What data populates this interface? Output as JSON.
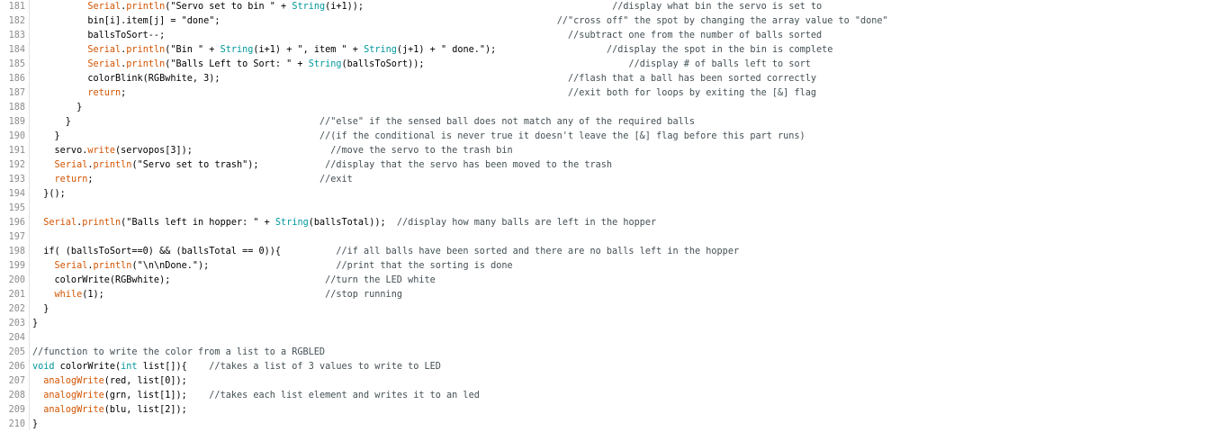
{
  "editor": {
    "lines": [
      {
        "n": "181",
        "segs": [
          [
            "p",
            "          "
          ],
          [
            "f",
            "Serial"
          ],
          [
            "p",
            "."
          ],
          [
            "f",
            "println"
          ],
          [
            "p",
            "(\"Servo set to bin \" + "
          ],
          [
            "t",
            "String"
          ],
          [
            "p",
            "(i+1));                                             "
          ],
          [
            "c",
            "//display what bin the servo is set to"
          ]
        ]
      },
      {
        "n": "182",
        "segs": [
          [
            "p",
            "          bin[i].item[j] = \"done\";                                                             "
          ],
          [
            "c",
            "//\"cross off\" the spot by changing the array value to \"done\""
          ]
        ]
      },
      {
        "n": "183",
        "segs": [
          [
            "p",
            "          ballsToSort--;                                                                         "
          ],
          [
            "c",
            "//subtract one from the number of balls sorted"
          ]
        ]
      },
      {
        "n": "184",
        "segs": [
          [
            "p",
            "          "
          ],
          [
            "f",
            "Serial"
          ],
          [
            "p",
            "."
          ],
          [
            "f",
            "println"
          ],
          [
            "p",
            "(\"Bin \" + "
          ],
          [
            "t",
            "String"
          ],
          [
            "p",
            "(i+1) + \", item \" + "
          ],
          [
            "t",
            "String"
          ],
          [
            "p",
            "(j+1) + \" done.\");                    "
          ],
          [
            "c",
            "//display the spot in the bin is complete"
          ]
        ]
      },
      {
        "n": "185",
        "segs": [
          [
            "p",
            "          "
          ],
          [
            "f",
            "Serial"
          ],
          [
            "p",
            "."
          ],
          [
            "f",
            "println"
          ],
          [
            "p",
            "(\"Balls Left to Sort: \" + "
          ],
          [
            "t",
            "String"
          ],
          [
            "p",
            "(ballsToSort));                                     "
          ],
          [
            "c",
            "//display # of balls left to sort"
          ]
        ]
      },
      {
        "n": "186",
        "segs": [
          [
            "p",
            "          colorBlink(RGBwhite, 3);                                                               "
          ],
          [
            "c",
            "//flash that a ball has been sorted correctly"
          ]
        ]
      },
      {
        "n": "187",
        "segs": [
          [
            "p",
            "          "
          ],
          [
            "f",
            "return"
          ],
          [
            "p",
            ";                                                                                "
          ],
          [
            "c",
            "//exit both for loops by exiting the [&] flag"
          ]
        ]
      },
      {
        "n": "188",
        "segs": [
          [
            "p",
            "        }"
          ]
        ]
      },
      {
        "n": "189",
        "segs": [
          [
            "p",
            "      }                                             "
          ],
          [
            "c",
            "//\"else\" if the sensed ball does not match any of the required balls"
          ]
        ]
      },
      {
        "n": "190",
        "segs": [
          [
            "p",
            "    }                                               "
          ],
          [
            "c",
            "//(if the conditional is never true it doesn't leave the [&] flag before this part runs)"
          ]
        ]
      },
      {
        "n": "191",
        "segs": [
          [
            "p",
            "    servo."
          ],
          [
            "f",
            "write"
          ],
          [
            "p",
            "(servopos[3]);                         "
          ],
          [
            "c",
            "//move the servo to the trash bin"
          ]
        ]
      },
      {
        "n": "192",
        "segs": [
          [
            "p",
            "    "
          ],
          [
            "f",
            "Serial"
          ],
          [
            "p",
            "."
          ],
          [
            "f",
            "println"
          ],
          [
            "p",
            "(\"Servo set to trash\");            "
          ],
          [
            "c",
            "//display that the servo has been moved to the trash"
          ]
        ]
      },
      {
        "n": "193",
        "segs": [
          [
            "p",
            "    "
          ],
          [
            "f",
            "return"
          ],
          [
            "p",
            ";                                         "
          ],
          [
            "c",
            "//exit"
          ]
        ]
      },
      {
        "n": "194",
        "segs": [
          [
            "p",
            "  }();"
          ]
        ]
      },
      {
        "n": "195",
        "segs": [
          [
            "p",
            ""
          ]
        ]
      },
      {
        "n": "196",
        "segs": [
          [
            "p",
            "  "
          ],
          [
            "f",
            "Serial"
          ],
          [
            "p",
            "."
          ],
          [
            "f",
            "println"
          ],
          [
            "p",
            "(\"Balls left in hopper: \" + "
          ],
          [
            "t",
            "String"
          ],
          [
            "p",
            "(ballsTotal));  "
          ],
          [
            "c",
            "//display how many balls are left in the hopper"
          ]
        ]
      },
      {
        "n": "197",
        "segs": [
          [
            "p",
            ""
          ]
        ]
      },
      {
        "n": "198",
        "segs": [
          [
            "p",
            "  if( (ballsToSort==0) && (ballsTotal == 0)){          "
          ],
          [
            "c",
            "//if all balls have been sorted and there are no balls left in the hopper"
          ]
        ]
      },
      {
        "n": "199",
        "segs": [
          [
            "p",
            "    "
          ],
          [
            "f",
            "Serial"
          ],
          [
            "p",
            "."
          ],
          [
            "f",
            "println"
          ],
          [
            "p",
            "(\"\\n\\nDone.\");                       "
          ],
          [
            "c",
            "//print that the sorting is done"
          ]
        ]
      },
      {
        "n": "200",
        "segs": [
          [
            "p",
            "    colorWrite(RGBwhite);                            "
          ],
          [
            "c",
            "//turn the LED white"
          ]
        ]
      },
      {
        "n": "201",
        "segs": [
          [
            "p",
            "    "
          ],
          [
            "f",
            "while"
          ],
          [
            "p",
            "(1);                                        "
          ],
          [
            "c",
            "//stop running"
          ]
        ]
      },
      {
        "n": "202",
        "segs": [
          [
            "p",
            "  }"
          ]
        ]
      },
      {
        "n": "203",
        "segs": [
          [
            "p",
            "}"
          ]
        ]
      },
      {
        "n": "204",
        "segs": [
          [
            "p",
            ""
          ]
        ]
      },
      {
        "n": "205",
        "segs": [
          [
            "c",
            "//function to write the color from a list to a RGBLED"
          ]
        ]
      },
      {
        "n": "206",
        "segs": [
          [
            "t",
            "void"
          ],
          [
            "p",
            " colorWrite("
          ],
          [
            "t",
            "int"
          ],
          [
            "p",
            " list[]){    "
          ],
          [
            "c",
            "//takes a list of 3 values to write to LED"
          ]
        ]
      },
      {
        "n": "207",
        "segs": [
          [
            "p",
            "  "
          ],
          [
            "f",
            "analogWrite"
          ],
          [
            "p",
            "(red, list[0]);"
          ]
        ]
      },
      {
        "n": "208",
        "segs": [
          [
            "p",
            "  "
          ],
          [
            "f",
            "analogWrite"
          ],
          [
            "p",
            "(grn, list[1]);    "
          ],
          [
            "c",
            "//takes each list element and writes it to an led"
          ]
        ]
      },
      {
        "n": "209",
        "segs": [
          [
            "p",
            "  "
          ],
          [
            "f",
            "analogWrite"
          ],
          [
            "p",
            "(blu, list[2]);"
          ]
        ]
      },
      {
        "n": "210",
        "segs": [
          [
            "p",
            "}"
          ]
        ]
      }
    ]
  },
  "colors": {
    "function": "#d35400",
    "type": "#00979c",
    "comment": "#434f54",
    "line_number": "#8c8c8c"
  }
}
